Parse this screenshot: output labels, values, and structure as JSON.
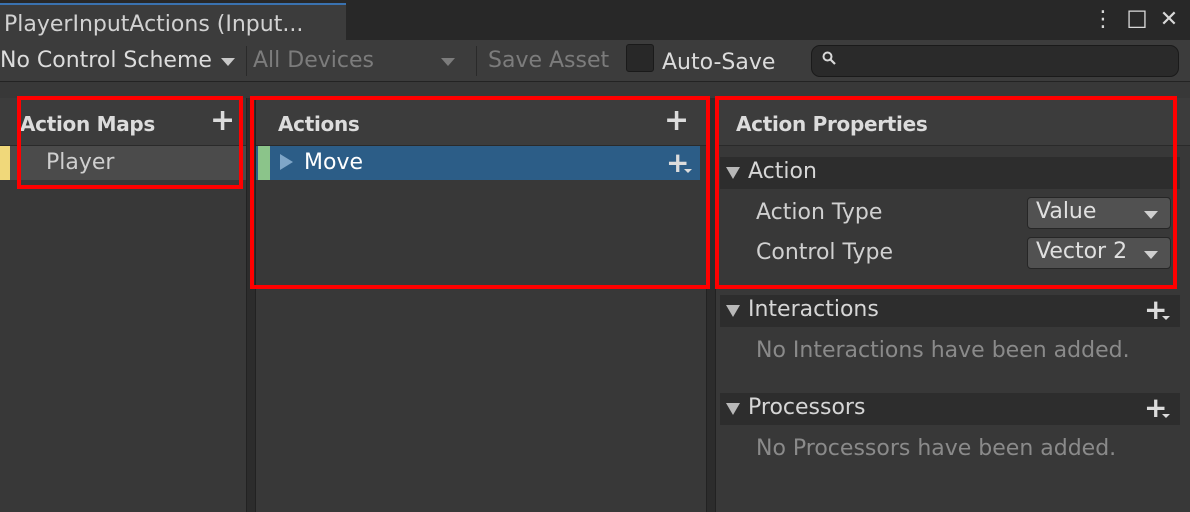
{
  "window": {
    "tab_title": "PlayerInputActions (Input...",
    "menu_glyph": "⋮",
    "maximize_glyph": "☐",
    "close_glyph": "✕"
  },
  "toolbar": {
    "control_scheme": "No Control Scheme",
    "devices": "All Devices",
    "save_label": "Save Asset",
    "autosave_label": "Auto-Save",
    "autosave_checked": false,
    "search_value": "",
    "search_glyph": "🔍"
  },
  "action_maps": {
    "title": "Action Maps",
    "add_glyph": "+",
    "items": [
      {
        "label": "Player",
        "selected": true
      }
    ]
  },
  "actions": {
    "title": "Actions",
    "add_glyph": "+",
    "items": [
      {
        "label": "Move",
        "selected": true,
        "expand_glyph": "▶"
      }
    ]
  },
  "properties": {
    "title": "Action Properties",
    "action_section": "Action",
    "action_type_label": "Action Type",
    "action_type_value": "Value",
    "control_type_label": "Control Type",
    "control_type_value": "Vector 2",
    "interactions_section": "Interactions",
    "interactions_empty": "No Interactions have been added.",
    "processors_section": "Processors",
    "processors_empty": "No Processors have been added."
  },
  "colors": {
    "accent_blue": "#2c5d87",
    "map_indicator": "#f0d87a",
    "action_indicator": "#8bc48a",
    "highlight": "#ff0000"
  }
}
